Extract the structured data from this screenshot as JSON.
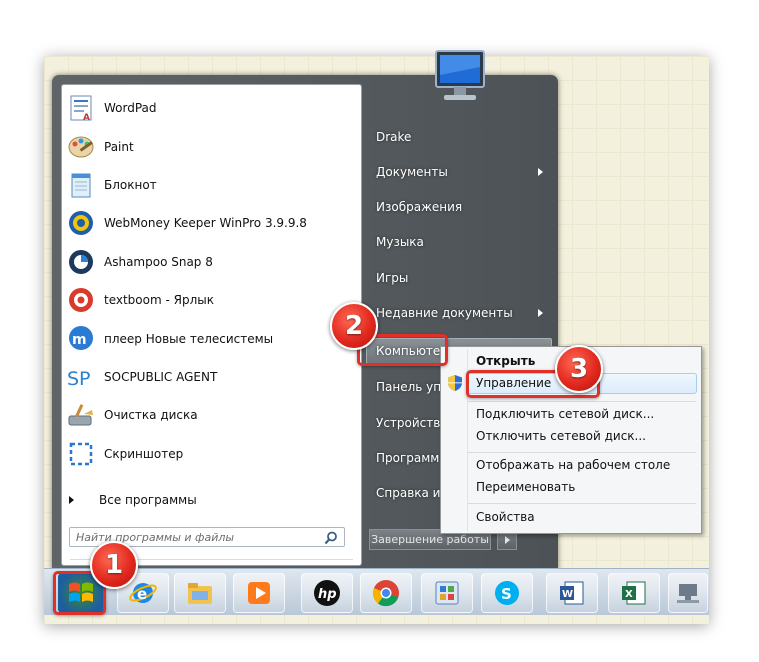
{
  "programs": [
    {
      "label": "WordPad",
      "icon": "wordpad-icon"
    },
    {
      "label": "Paint",
      "icon": "paint-icon"
    },
    {
      "label": "Блокнот",
      "icon": "notepad-icon"
    },
    {
      "label": "WebMoney Keeper WinPro 3.9.9.8",
      "icon": "webmoney-icon"
    },
    {
      "label": "Ashampoo Snap 8",
      "icon": "ashampoo-icon"
    },
    {
      "label": "textboom - Ярлык",
      "icon": "textboom-icon"
    },
    {
      "label": "плеер Новые телесистемы",
      "icon": "player-icon"
    },
    {
      "label": "SOCPUBLIC AGENT",
      "icon": "socpublic-icon",
      "logo_text": "SP"
    },
    {
      "label": "Очистка диска",
      "icon": "disk-cleanup-icon"
    },
    {
      "label": "Скриншотер",
      "icon": "screenshoter-icon"
    }
  ],
  "all_programs": "Все программы",
  "search_placeholder": "Найти программы и файлы",
  "right_items": [
    {
      "label": "Drake"
    },
    {
      "label": "Документы",
      "submenu": true
    },
    {
      "label": "Изображения"
    },
    {
      "label": "Музыка"
    },
    {
      "label": "Игры"
    },
    {
      "label": "Недавние документы",
      "submenu": true
    },
    {
      "label": "Компьютер"
    },
    {
      "label": "Панель упр"
    },
    {
      "label": "Устройства"
    },
    {
      "label": "Программ"
    },
    {
      "label": "Справка и п"
    }
  ],
  "shutdown_label": "Завершение работы",
  "context_menu": {
    "open": "Открыть",
    "manage": "Управление",
    "map_drive": "Подключить сетевой диск...",
    "disconnect_drive": "Отключить сетевой диск...",
    "show_on_desktop": "Отображать на рабочем столе",
    "rename": "Переименовать",
    "properties": "Свойства"
  },
  "callouts": [
    "1",
    "2",
    "3"
  ],
  "taskbar_icons": [
    "internet-explorer-icon",
    "file-explorer-icon",
    "media-player-icon",
    "hp-icon",
    "chrome-icon",
    "control-panel-icon",
    "skype-icon",
    "word-icon",
    "excel-icon",
    "network-icon"
  ],
  "colors": {
    "callout_red": "#e0302a",
    "menu_dark": "#52585c",
    "highlight_blue": "#dcecfc"
  }
}
